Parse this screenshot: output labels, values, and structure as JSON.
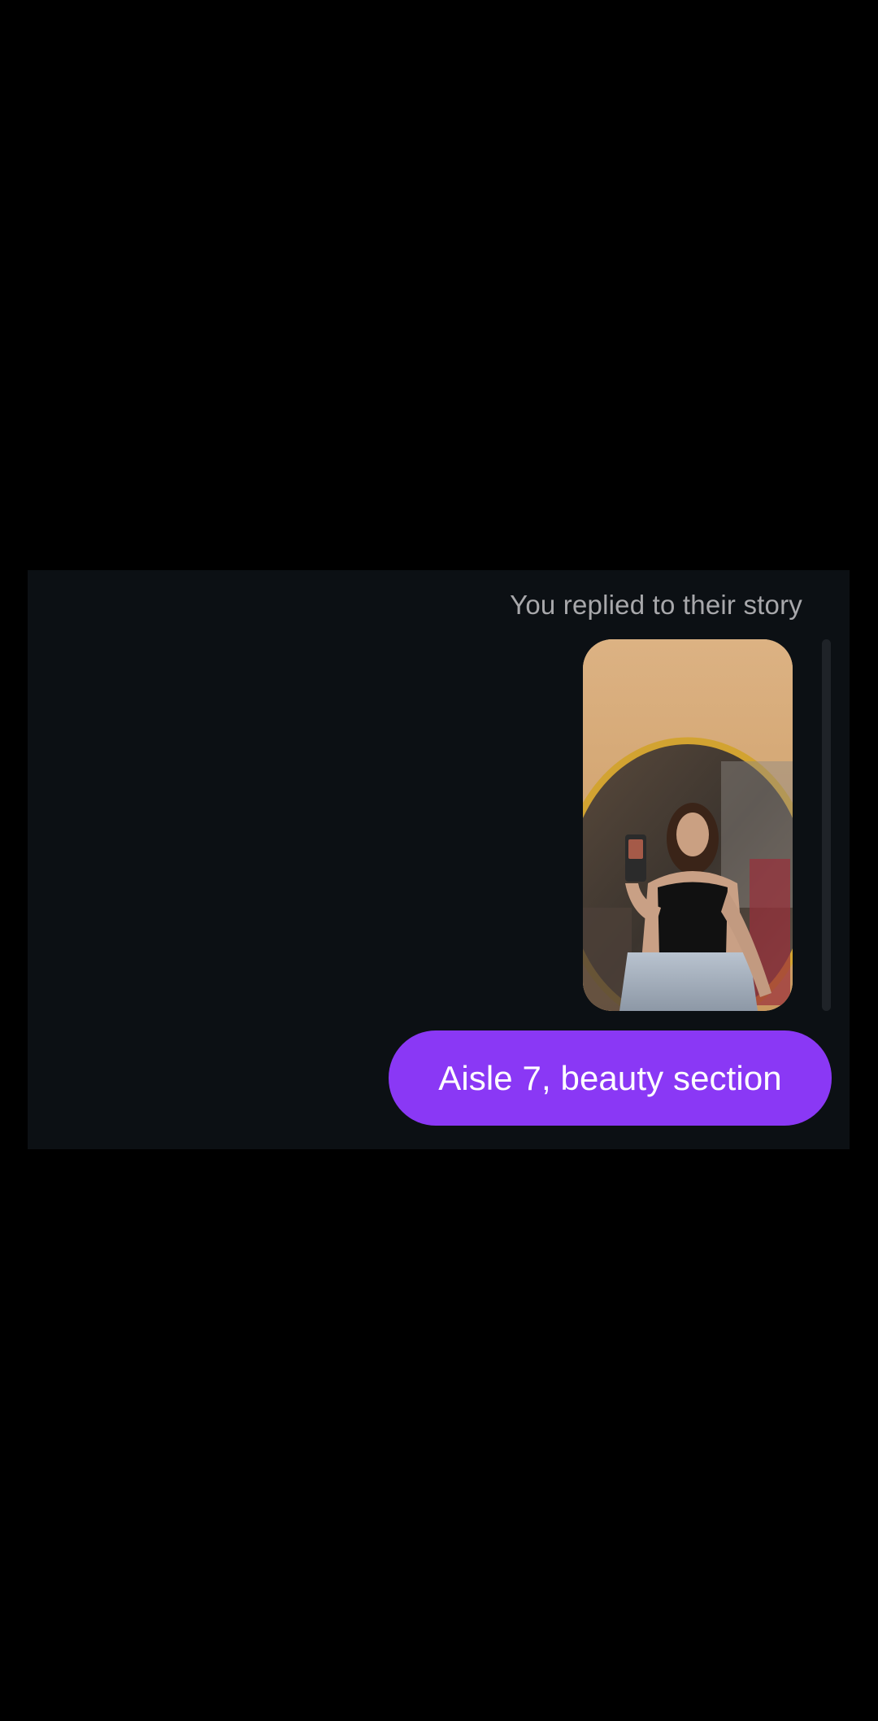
{
  "conversation": {
    "story_reply_label": "You replied to their story",
    "story_thumbnail_icon": "story-photo-image",
    "messages": [
      {
        "text": "Aisle 7, beauty section",
        "sender": "me"
      }
    ]
  },
  "colors": {
    "page_background": "#000000",
    "chat_background": "#0c1014",
    "bubble_sent": "#8a38f5",
    "label_text": "#a8a8ab",
    "message_text": "#ffffff"
  }
}
